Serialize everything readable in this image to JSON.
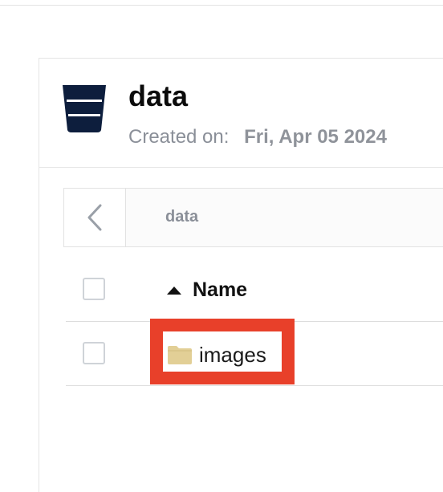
{
  "bucket": {
    "name": "data",
    "created_label": "Created on:",
    "created_date": "Fri, Apr 05 2024",
    "icon": "bucket-icon"
  },
  "browser": {
    "current_path": "data",
    "back_icon": "chevron-left-icon",
    "columns": [
      {
        "label": "Name",
        "sort": "ascending"
      }
    ],
    "items": [
      {
        "name": "images",
        "type": "folder",
        "icon": "folder-icon",
        "highlighted": true
      }
    ]
  },
  "colors": {
    "bucket_icon": "#0d1e3d",
    "folder": "#e2cf96",
    "highlight": "#e8402a"
  }
}
